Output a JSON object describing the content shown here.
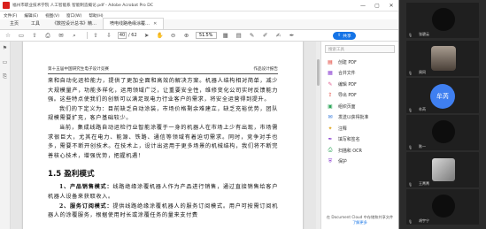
{
  "window": {
    "title": "福州市职业技术学院 人工智能系 智能制造概论.pdf - Adobe Acrobat Pro DC"
  },
  "menu": [
    "文件(F)",
    "编辑(E)",
    "视图(V)",
    "窗口(W)",
    "帮助(H)"
  ],
  "tabs": {
    "home": "主页",
    "tools": "工具",
    "document": "《数控设计总书》精…",
    "document2": "喷电线路绝缘涂覆…"
  },
  "toolbar": {
    "current_page": "40",
    "total_pages": "/ 62",
    "zoom": "51.5%",
    "share_label": "共享"
  },
  "document": {
    "running_head_left": "第十五届中国研究生电子设计竞赛",
    "running_head_right": "作品设计报告",
    "paragraphs": [
      "来和自动化运检能力，提供了更加全面和高效的解决方案。机器人结构相对简单，减少大规模量产，功能多样化，运用领域广泛，让重要安全性，维修变化公司实时反馈能力强。这些特点使我们的创新可以满足现电力行业客户的需求，将安全运营得到提升。",
      "我们的下定义为：目前缺乏自动涂装，市场价格剩余难建立，缺乏充裕优势，团队规模需要扩充，客户基础较少。",
      "当前，集成线路自动运检行业智能涂覆于一身的机器人在市场上少有出现，市场需求很巨大，尤其在电力、能源、铁路、通信等领域有着迫切需求。同时，竞争对手也多，需要不断开创技术。在技术上，设计出运用于更多场景的机械结构，我们将不断完善核心技术，增强优势，把握机遇！"
    ],
    "section_title": "1.5 盈利模式",
    "items": [
      {
        "term": "1、产品销售模式：",
        "text": "线路绝缘涂覆机器人作为产品进行销售，通过直接销售给客户机器人设备来获取收入。"
      },
      {
        "term": "2、服务订阅模式：",
        "text": "提供线路绝缘涂覆机器人的服务订阅模式。用户可按需订阅机器人的涂覆服务，根据使用时长或涂覆任务的量来支付费"
      }
    ]
  },
  "side_panel": {
    "search_placeholder": "搜索工具",
    "tools": [
      {
        "label": "创建 PDF",
        "icon": "create-pdf-icon",
        "color": "#e0352a",
        "glyph": "▤"
      },
      {
        "label": "合并文件",
        "icon": "combine-files-icon",
        "color": "#8b3fd1",
        "glyph": "▦"
      },
      {
        "label": "编辑 PDF",
        "icon": "edit-pdf-icon",
        "color": "#e0548a",
        "glyph": "✎"
      },
      {
        "label": "导出 PDF",
        "icon": "export-pdf-icon",
        "color": "#e0352a",
        "glyph": "⇪"
      },
      {
        "label": "组织页面",
        "icon": "organize-pages-icon",
        "color": "#2ea65a",
        "glyph": "▣"
      },
      {
        "label": "发送以获得批准",
        "icon": "send-for-approval-icon",
        "color": "#2a72d8",
        "glyph": "✉"
      },
      {
        "label": "注释",
        "icon": "comment-icon",
        "color": "#e0a820",
        "glyph": "✦"
      },
      {
        "label": "填写和签名",
        "icon": "fill-sign-icon",
        "color": "#8b3fd1",
        "glyph": "✒"
      },
      {
        "label": "扫描和 OCR",
        "icon": "scan-ocr-icon",
        "color": "#2ea65a",
        "glyph": "⎙"
      },
      {
        "label": "保护",
        "icon": "protect-icon",
        "color": "#8b3fd1",
        "glyph": "⛨"
      }
    ],
    "footer": "在 Document Cloud 中存储和共享文件",
    "footer_link": "了解更多"
  },
  "participants": [
    {
      "name": "张碧云",
      "avatar": "dark"
    },
    {
      "name": "周同",
      "avatar": "photo"
    },
    {
      "name": "牟芮",
      "avatar": "text",
      "avatar_text": "牟芮"
    },
    {
      "name": "陈一",
      "avatar": "dark"
    },
    {
      "name": "王菁菁",
      "avatar": "grey"
    },
    {
      "name": "胡宇宁",
      "avatar": "dark"
    }
  ]
}
